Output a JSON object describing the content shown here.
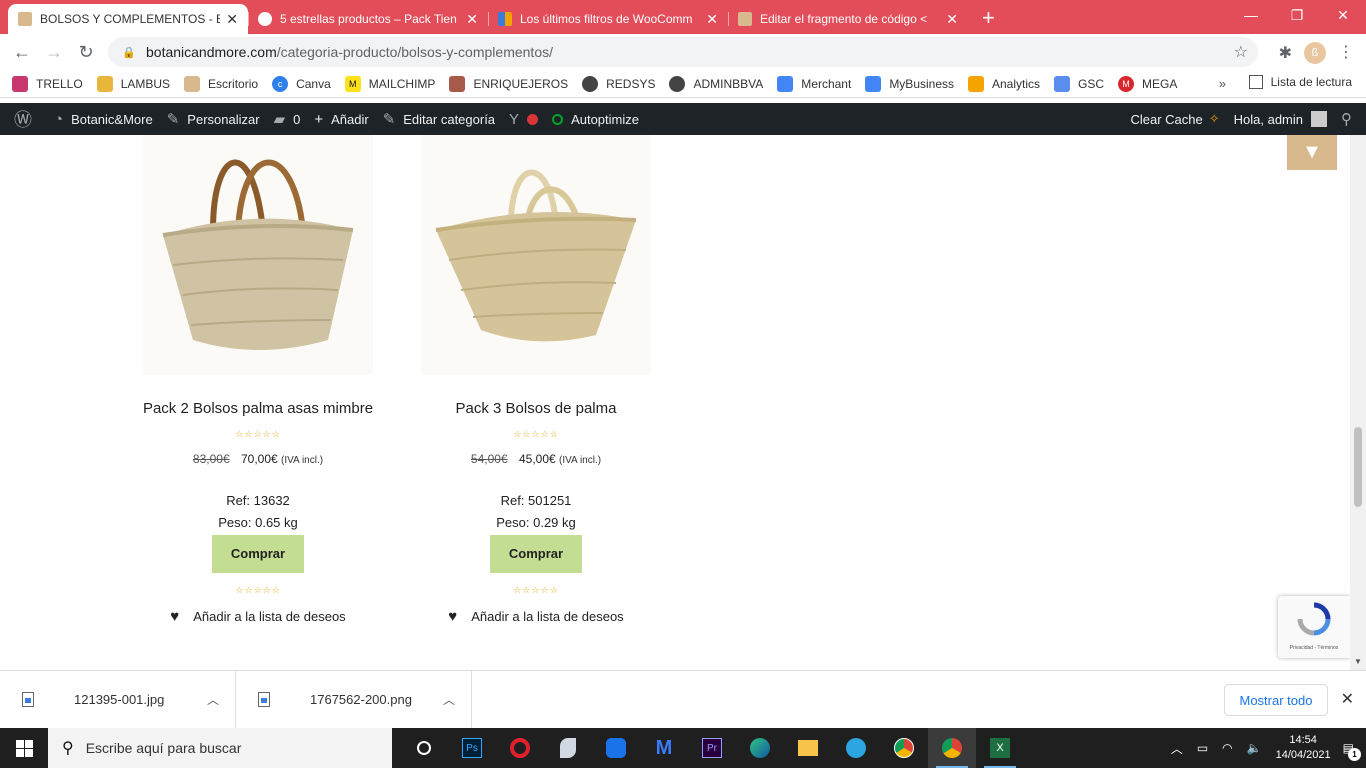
{
  "browser": {
    "tabs": [
      {
        "title": "BOLSOS Y COMPLEMENTOS - Bo",
        "icon": "botanic-favicon",
        "active": true
      },
      {
        "title": "5 estrellas productos – Pack Tien",
        "icon": "woo-favicon",
        "active": false
      },
      {
        "title": "Los últimos filtros de WooComm",
        "icon": "blog-favicon",
        "active": false
      },
      {
        "title": "Editar el fragmento de código <",
        "icon": "botanic-favicon",
        "active": false
      }
    ],
    "url_host": "botanicandmore.com",
    "url_path": "/categoria-producto/bolsos-y-complementos/",
    "bookmarks": [
      {
        "label": "TRELLO",
        "color": "#c9376e"
      },
      {
        "label": "LAMBUS",
        "color": "#e8b63a"
      },
      {
        "label": "Escritorio",
        "color": "#d8b98e"
      },
      {
        "label": "Canva",
        "color": "#2f80ed"
      },
      {
        "label": "MAILCHIMP",
        "color": "#ffe01b"
      },
      {
        "label": "ENRIQUEJEROS",
        "color": "#a55a4a"
      },
      {
        "label": "REDSYS",
        "color": "#444444"
      },
      {
        "label": "ADMINBBVA",
        "color": "#444444"
      },
      {
        "label": "Merchant",
        "color": "#4285f4"
      },
      {
        "label": "MyBusiness",
        "color": "#4285f4"
      },
      {
        "label": "Analytics",
        "color": "#f4a300"
      },
      {
        "label": "GSC",
        "color": "#5b8def"
      },
      {
        "label": "MEGA",
        "color": "#d9272e"
      }
    ],
    "reading_list": "Lista de lectura",
    "more": "»"
  },
  "wpbar": {
    "site": "Botanic&More",
    "customize": "Personalizar",
    "comments": "0",
    "add": "Añadir",
    "edit_category": "Editar categoría",
    "autoptimize": "Autoptimize",
    "clear_cache": "Clear Cache",
    "greeting": "Hola, admin"
  },
  "products": [
    {
      "name": "Pack 2 Bolsos palma asas mimbre",
      "old_price": "83,00€",
      "price": "70,00€",
      "tax": "(IVA incl.)",
      "ref": "Ref: 13632",
      "weight": "Peso: 0.65 kg",
      "buy": "Comprar",
      "wishlist": "Añadir a la lista de deseos"
    },
    {
      "name": "Pack 3 Bolsos de palma",
      "old_price": "54,00€",
      "price": "45,00€",
      "tax": "(IVA incl.)",
      "ref": "Ref: 501251",
      "weight": "Peso: 0.29 kg",
      "buy": "Comprar",
      "wishlist": "Añadir a la lista de deseos"
    }
  ],
  "recaptcha": {
    "links": "Privacidad - Términos"
  },
  "downloads": [
    {
      "name": "121395-001.jpg"
    },
    {
      "name": "1767562-200.png"
    }
  ],
  "show_all": "Mostrar todo",
  "taskbar": {
    "search_placeholder": "Escribe aquí para buscar",
    "time": "14:54",
    "date": "14/04/2021",
    "notifications": "1"
  },
  "colors": {
    "tab_strip": "#e34d5a",
    "buy_button": "#c3de92",
    "accent": "#d8b98e",
    "wpbar": "#1d2327"
  }
}
